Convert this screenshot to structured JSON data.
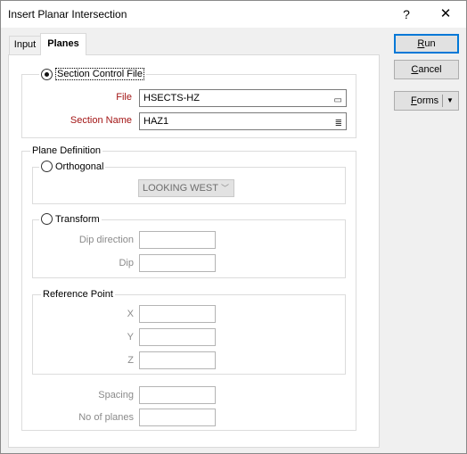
{
  "window": {
    "title": "Insert Planar Intersection",
    "help_glyph": "?",
    "close_glyph": "✕"
  },
  "tabs": [
    {
      "label": "Input"
    },
    {
      "label": "Planes"
    }
  ],
  "section_control": {
    "radio_label": "Section Control File",
    "file": {
      "label": "File",
      "value": "HSECTS-HZ"
    },
    "section_name": {
      "label": "Section Name",
      "value": "HAZ1"
    }
  },
  "plane_definition": {
    "title": "Plane Definition",
    "orthogonal": {
      "label": "Orthogonal",
      "select_value": "LOOKING WEST"
    },
    "transform": {
      "label": "Transform",
      "dip_direction_label": "Dip direction",
      "dip_label": "Dip"
    },
    "reference_point": {
      "title": "Reference Point",
      "x_label": "X",
      "y_label": "Y",
      "z_label": "Z"
    },
    "spacing_label": "Spacing",
    "no_of_planes_label": "No of planes"
  },
  "buttons": {
    "run_first": "R",
    "run_rest": "un",
    "cancel_first": "C",
    "cancel_rest": "ancel",
    "forms_first": "F",
    "forms_rest": "orms"
  },
  "colors": {
    "required_label": "#a31515",
    "primary_border": "#0078d7"
  }
}
